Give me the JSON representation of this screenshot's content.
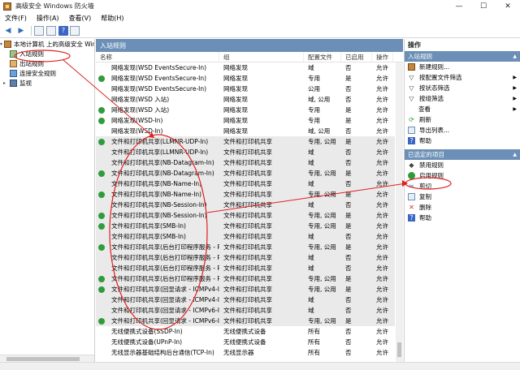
{
  "window": {
    "title": "高级安全 Windows 防火墙",
    "minimize": "—",
    "maximize": "☐",
    "close": "✕"
  },
  "menu": [
    "文件(F)",
    "操作(A)",
    "查看(V)",
    "帮助(H)"
  ],
  "tree": {
    "root": "本地计算机 上的高级安全 Windows",
    "inbound": "入站规则",
    "outbound": "出站规则",
    "connection_security": "连接安全规则",
    "monitoring": "监视"
  },
  "center": {
    "header": "入站规则",
    "columns": [
      "名称",
      "组",
      "配置文件",
      "已启用",
      "操作"
    ],
    "rows": [
      {
        "name": "网络发现(WSD EventsSecure-In)",
        "group": "网络发现",
        "profile": "域",
        "enabled": "否",
        "action": "允许",
        "on": false,
        "hl": false
      },
      {
        "name": "网络发现(WSD EventsSecure-In)",
        "group": "网络发现",
        "profile": "专用",
        "enabled": "是",
        "action": "允许",
        "on": true,
        "hl": false
      },
      {
        "name": "网络发现(WSD EventsSecure-In)",
        "group": "网络发现",
        "profile": "公用",
        "enabled": "否",
        "action": "允许",
        "on": false,
        "hl": false
      },
      {
        "name": "网络发现(WSD 入站)",
        "group": "网络发现",
        "profile": "域, 公用",
        "enabled": "否",
        "action": "允许",
        "on": false,
        "hl": false
      },
      {
        "name": "网络发现(WSD 入站)",
        "group": "网络发现",
        "profile": "专用",
        "enabled": "是",
        "action": "允许",
        "on": true,
        "hl": false
      },
      {
        "name": "网络发现(WSD-In)",
        "group": "网络发现",
        "profile": "专用",
        "enabled": "是",
        "action": "允许",
        "on": true,
        "hl": false
      },
      {
        "name": "网络发现(WSD-In)",
        "group": "网络发现",
        "profile": "域, 公用",
        "enabled": "否",
        "action": "允许",
        "on": false,
        "hl": false
      },
      {
        "name": "文件和打印机共享(LLMNR-UDP-In)",
        "group": "文件和打印机共享",
        "profile": "专用, 公用",
        "enabled": "是",
        "action": "允许",
        "on": true,
        "hl": true
      },
      {
        "name": "文件和打印机共享(LLMNR-UDP-In)",
        "group": "文件和打印机共享",
        "profile": "域",
        "enabled": "否",
        "action": "允许",
        "on": false,
        "hl": true
      },
      {
        "name": "文件和打印机共享(NB-Datagram-In)",
        "group": "文件和打印机共享",
        "profile": "域",
        "enabled": "否",
        "action": "允许",
        "on": false,
        "hl": true
      },
      {
        "name": "文件和打印机共享(NB-Datagram-In)",
        "group": "文件和打印机共享",
        "profile": "专用, 公用",
        "enabled": "是",
        "action": "允许",
        "on": true,
        "hl": true
      },
      {
        "name": "文件和打印机共享(NB-Name-In)",
        "group": "文件和打印机共享",
        "profile": "域",
        "enabled": "否",
        "action": "允许",
        "on": false,
        "hl": true
      },
      {
        "name": "文件和打印机共享(NB-Name-In)",
        "group": "文件和打印机共享",
        "profile": "专用, 公用",
        "enabled": "是",
        "action": "允许",
        "on": true,
        "hl": true
      },
      {
        "name": "文件和打印机共享(NB-Session-In)",
        "group": "文件和打印机共享",
        "profile": "域",
        "enabled": "否",
        "action": "允许",
        "on": false,
        "hl": true
      },
      {
        "name": "文件和打印机共享(NB-Session-In)",
        "group": "文件和打印机共享",
        "profile": "专用, 公用",
        "enabled": "是",
        "action": "允许",
        "on": true,
        "hl": true
      },
      {
        "name": "文件和打印机共享(SMB-In)",
        "group": "文件和打印机共享",
        "profile": "专用, 公用",
        "enabled": "是",
        "action": "允许",
        "on": true,
        "hl": true
      },
      {
        "name": "文件和打印机共享(SMB-In)",
        "group": "文件和打印机共享",
        "profile": "域",
        "enabled": "否",
        "action": "允许",
        "on": false,
        "hl": true
      },
      {
        "name": "文件和打印机共享(后台打印程序服务 - R...",
        "group": "文件和打印机共享",
        "profile": "专用, 公用",
        "enabled": "是",
        "action": "允许",
        "on": true,
        "hl": true
      },
      {
        "name": "文件和打印机共享(后台打印程序服务 - R...",
        "group": "文件和打印机共享",
        "profile": "域",
        "enabled": "否",
        "action": "允许",
        "on": false,
        "hl": true
      },
      {
        "name": "文件和打印机共享(后台打印程序服务 - R...",
        "group": "文件和打印机共享",
        "profile": "域",
        "enabled": "否",
        "action": "允许",
        "on": false,
        "hl": true
      },
      {
        "name": "文件和打印机共享(后台打印程序服务 - R...",
        "group": "文件和打印机共享",
        "profile": "专用, 公用",
        "enabled": "是",
        "action": "允许",
        "on": true,
        "hl": true
      },
      {
        "name": "文件和打印机共享(回显请求 - ICMPv4-In)",
        "group": "文件和打印机共享",
        "profile": "专用, 公用",
        "enabled": "是",
        "action": "允许",
        "on": true,
        "hl": true
      },
      {
        "name": "文件和打印机共享(回显请求 - ICMPv4-In)",
        "group": "文件和打印机共享",
        "profile": "域",
        "enabled": "否",
        "action": "允许",
        "on": false,
        "hl": true
      },
      {
        "name": "文件和打印机共享(回显请求 - ICMPv6-In)",
        "group": "文件和打印机共享",
        "profile": "域",
        "enabled": "否",
        "action": "允许",
        "on": false,
        "hl": true
      },
      {
        "name": "文件和打印机共享(回显请求 - ICMPv6-In)",
        "group": "文件和打印机共享",
        "profile": "专用, 公用",
        "enabled": "是",
        "action": "允许",
        "on": true,
        "hl": true
      },
      {
        "name": "无线便携式设备(SSDP-In)",
        "group": "无线便携式设备",
        "profile": "所有",
        "enabled": "否",
        "action": "允许",
        "on": false,
        "hl": false
      },
      {
        "name": "无线便携式设备(UPnP-In)",
        "group": "无线便携式设备",
        "profile": "所有",
        "enabled": "否",
        "action": "允许",
        "on": false,
        "hl": false
      },
      {
        "name": "无线显示器基础结构后台通信(TCP-In)",
        "group": "无线显示器",
        "profile": "所有",
        "enabled": "否",
        "action": "允许",
        "on": false,
        "hl": false
      }
    ]
  },
  "actions": {
    "title": "操作",
    "section1": "入站规则",
    "items1": [
      {
        "label": "新建规则...",
        "icon": "new-rule-icon",
        "sub": false
      },
      {
        "label": "按配置文件筛选",
        "icon": "filter-icon",
        "sub": true
      },
      {
        "label": "按状态筛选",
        "icon": "filter-icon",
        "sub": true
      },
      {
        "label": "按组筛选",
        "icon": "filter-icon",
        "sub": true
      },
      {
        "label": "查看",
        "icon": "",
        "sub": true
      },
      {
        "label": "刷新",
        "icon": "refresh-icon",
        "sub": false
      },
      {
        "label": "导出列表...",
        "icon": "export-icon",
        "sub": false
      },
      {
        "label": "帮助",
        "icon": "help-icon",
        "sub": false
      }
    ],
    "section2": "已选定的项目",
    "items2": [
      {
        "label": "禁用规则",
        "icon": "disable-icon"
      },
      {
        "label": "启用规则",
        "icon": "enable-icon"
      },
      {
        "label": "剪切",
        "icon": "cut-icon"
      },
      {
        "label": "复制",
        "icon": "copy-icon"
      },
      {
        "label": "删除",
        "icon": "delete-icon"
      },
      {
        "label": "帮助",
        "icon": "help-icon"
      }
    ]
  },
  "colors": {
    "header_blue": "#6b8fb6",
    "enabled_green": "#2f9c3c",
    "annotation_red": "#e02020"
  }
}
